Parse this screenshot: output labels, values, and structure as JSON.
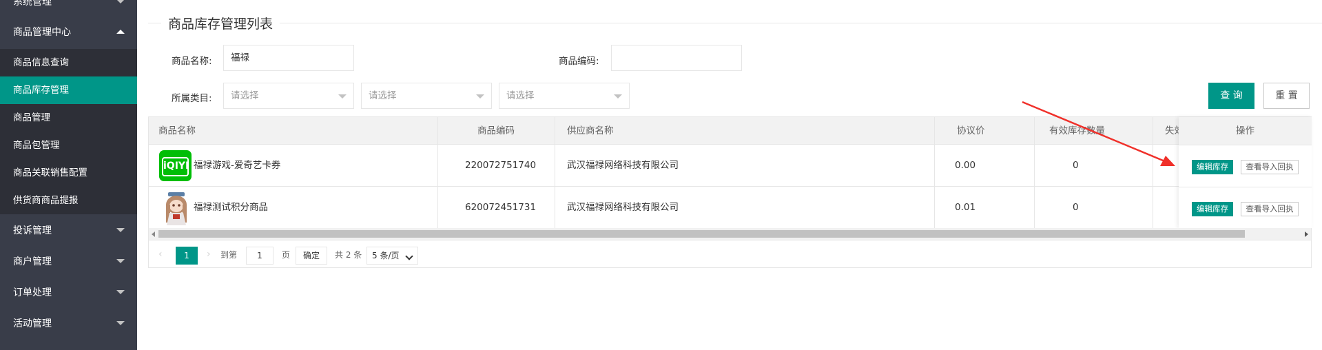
{
  "sidebar": {
    "top_item": "系统管理",
    "center": {
      "label": "商品管理中心",
      "items": [
        "商品信息查询",
        "商品库存管理",
        "商品管理",
        "商品包管理",
        "商品关联销售配置",
        "供货商商品提报"
      ]
    },
    "groups": [
      "投诉管理",
      "商户管理",
      "订单处理",
      "活动管理"
    ]
  },
  "page": {
    "legend": "商品库存管理列表"
  },
  "form": {
    "name_label": "商品名称:",
    "name_value": "福禄",
    "code_label": "商品编码:",
    "code_value": "",
    "category_label": "所属类目:",
    "selects": [
      "请选择",
      "请选择",
      "请选择"
    ],
    "query_btn": "查 询",
    "reset_btn": "重 置"
  },
  "table": {
    "headers": {
      "name": "商品名称",
      "code": "商品编码",
      "supplier": "供应商名称",
      "price": "协议价",
      "stock": "有效库存数量",
      "lost": "失效",
      "ops": "操作"
    },
    "rows": [
      {
        "name": "福禄游戏-爱奇艺卡券",
        "code": "220072751740",
        "supplier": "武汉福禄网络科技有限公司",
        "price": "0.00",
        "stock": "0",
        "logo": "iqiyi-logo"
      },
      {
        "name": "福禄测试积分商品",
        "code": "620072451731",
        "supplier": "武汉福禄网络科技有限公司",
        "price": "0.01",
        "stock": "0",
        "logo": "anime-girl-avatar"
      }
    ],
    "iqiyi_text": "iQIYI",
    "btn_edit": "编辑库存",
    "btn_view": "查看导入回执"
  },
  "pager": {
    "current": "1",
    "goto": "到第",
    "page_input": "1",
    "page_unit": "页",
    "confirm": "确定",
    "total": "共 2 条",
    "limit": "5 条/页"
  },
  "colors": {
    "accent": "#009688",
    "sidebar": "#393d49",
    "sidebar_sub": "#2d2f37",
    "arrow": "#f0302a"
  }
}
